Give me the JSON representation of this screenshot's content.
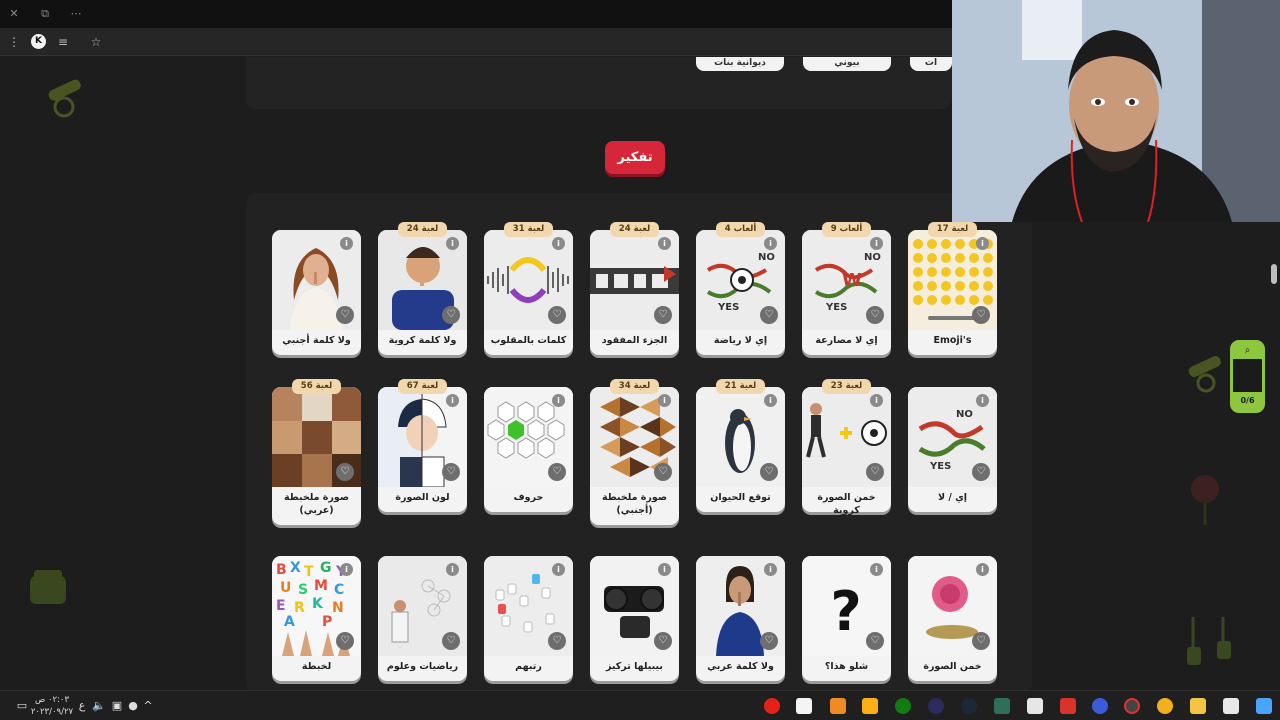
{
  "browser": {
    "window_buttons": [
      "✕",
      "⧉",
      "⋯"
    ],
    "profile_initial": "K"
  },
  "top_categories": [
    "ديوانية بنات",
    "بيوني",
    "ات"
  ],
  "section_button": "تفكير",
  "cards": [
    {
      "title": "ولا كلمة أجنبي",
      "badge": ""
    },
    {
      "title": "ولا كلمة كروية",
      "badge": "24 لعبة"
    },
    {
      "title": "كلمات بالمقلوب",
      "badge": "31 لعبة"
    },
    {
      "title": "الجزء المفقود",
      "badge": "24 لعبة"
    },
    {
      "title": "إي لا رياضة",
      "badge": "4 ألعاب"
    },
    {
      "title": "إي لا مصارعة",
      "badge": "9 ألعاب"
    },
    {
      "title": "Emoji's",
      "badge": "17 لعبة"
    },
    {
      "title": "صورة ملخبطة (عربي)",
      "badge": "56 لعبة"
    },
    {
      "title": "لون الصورة",
      "badge": "67 لعبة"
    },
    {
      "title": "حروف",
      "badge": ""
    },
    {
      "title": "صورة ملخبطة (أجنبي)",
      "badge": "34 لعبة"
    },
    {
      "title": "توقع الحيوان",
      "badge": "21 لعبة"
    },
    {
      "title": "خمن الصورة كروية",
      "badge": "23 لعبة"
    },
    {
      "title": "إي / لا",
      "badge": ""
    },
    {
      "title": "لخبطة",
      "badge": ""
    },
    {
      "title": "رياضيات وعلوم",
      "badge": ""
    },
    {
      "title": "رتبهم",
      "badge": ""
    },
    {
      "title": "بيبيلها تركيز",
      "badge": ""
    },
    {
      "title": "ولا كلمة عربي",
      "badge": ""
    },
    {
      "title": "شلو هذا؟",
      "badge": ""
    },
    {
      "title": "خمن الصورة",
      "badge": ""
    }
  ],
  "card_icons": {
    "info": "i",
    "heart": "♡"
  },
  "widget": {
    "search_icon": "⌕",
    "counter": "0/6"
  },
  "taskbar": {
    "time": "٠٢:٠٣ ص",
    "date": "٢٠٢٣/٠٩/٢٧",
    "lang": "ع"
  },
  "colors": {
    "accent_red": "#d6263a",
    "accent_green": "#8dc63f",
    "badge_bg": "#f1d7ae"
  }
}
